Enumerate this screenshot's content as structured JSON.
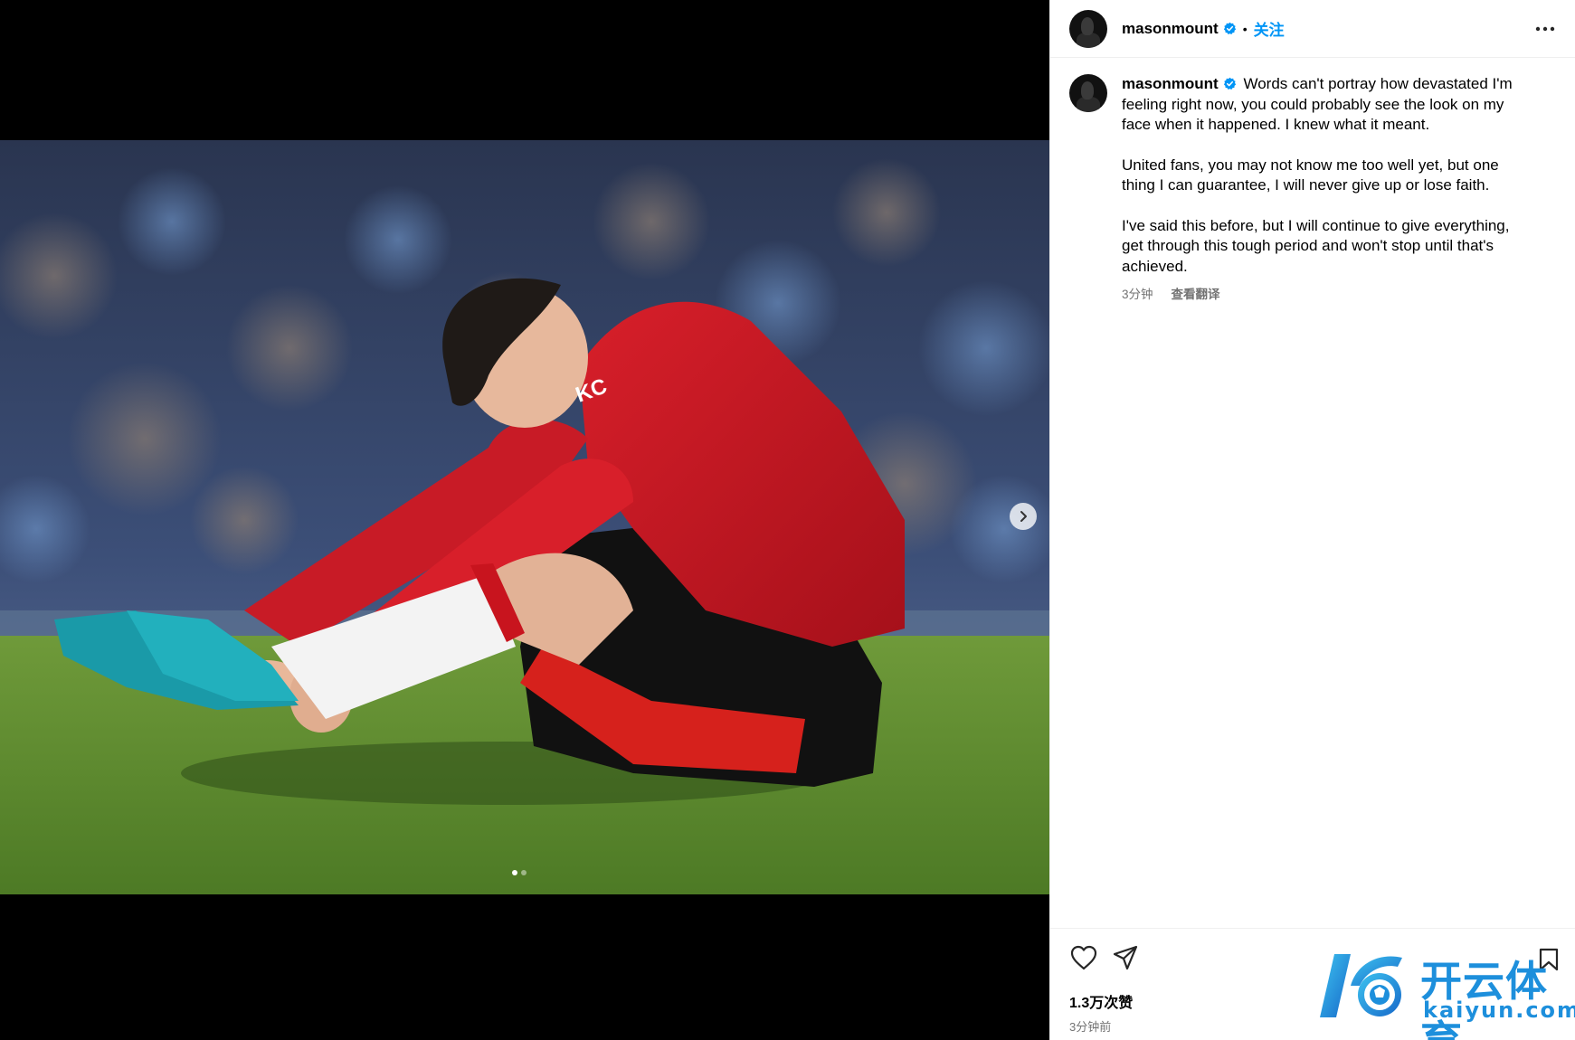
{
  "post": {
    "username": "masonmount",
    "follow_label": "关注",
    "separator": "•",
    "caption_p1": "Words can't portray how devastated I'm feeling right now, you could probably see the look on my face when it happened. I knew what it meant.",
    "caption_p2": "United fans, you may not know me too well yet, but one thing I can guarantee, I will never give up or lose faith.",
    "caption_p3": "I've said this before, but I will continue to give everything, get through this tough period and won't stop until that's achieved.",
    "caption_time": "3分钟",
    "translate_label": "查看翻译",
    "likes": "1.3万次赞",
    "posted_ago": "3分钟前",
    "carousel": {
      "total": 2,
      "current": 1
    }
  },
  "watermark": {
    "cn": "开云体育",
    "en": "kaiyun.com"
  },
  "icons": {
    "heart": "heart-icon",
    "share": "share-icon",
    "bookmark": "bookmark-icon",
    "more": "more-options-icon",
    "verified": "verified-badge-icon",
    "next": "chevron-right-icon"
  },
  "colors": {
    "accent": "#0095f6",
    "muted": "#737373",
    "watermark": "#1d8fdc"
  }
}
